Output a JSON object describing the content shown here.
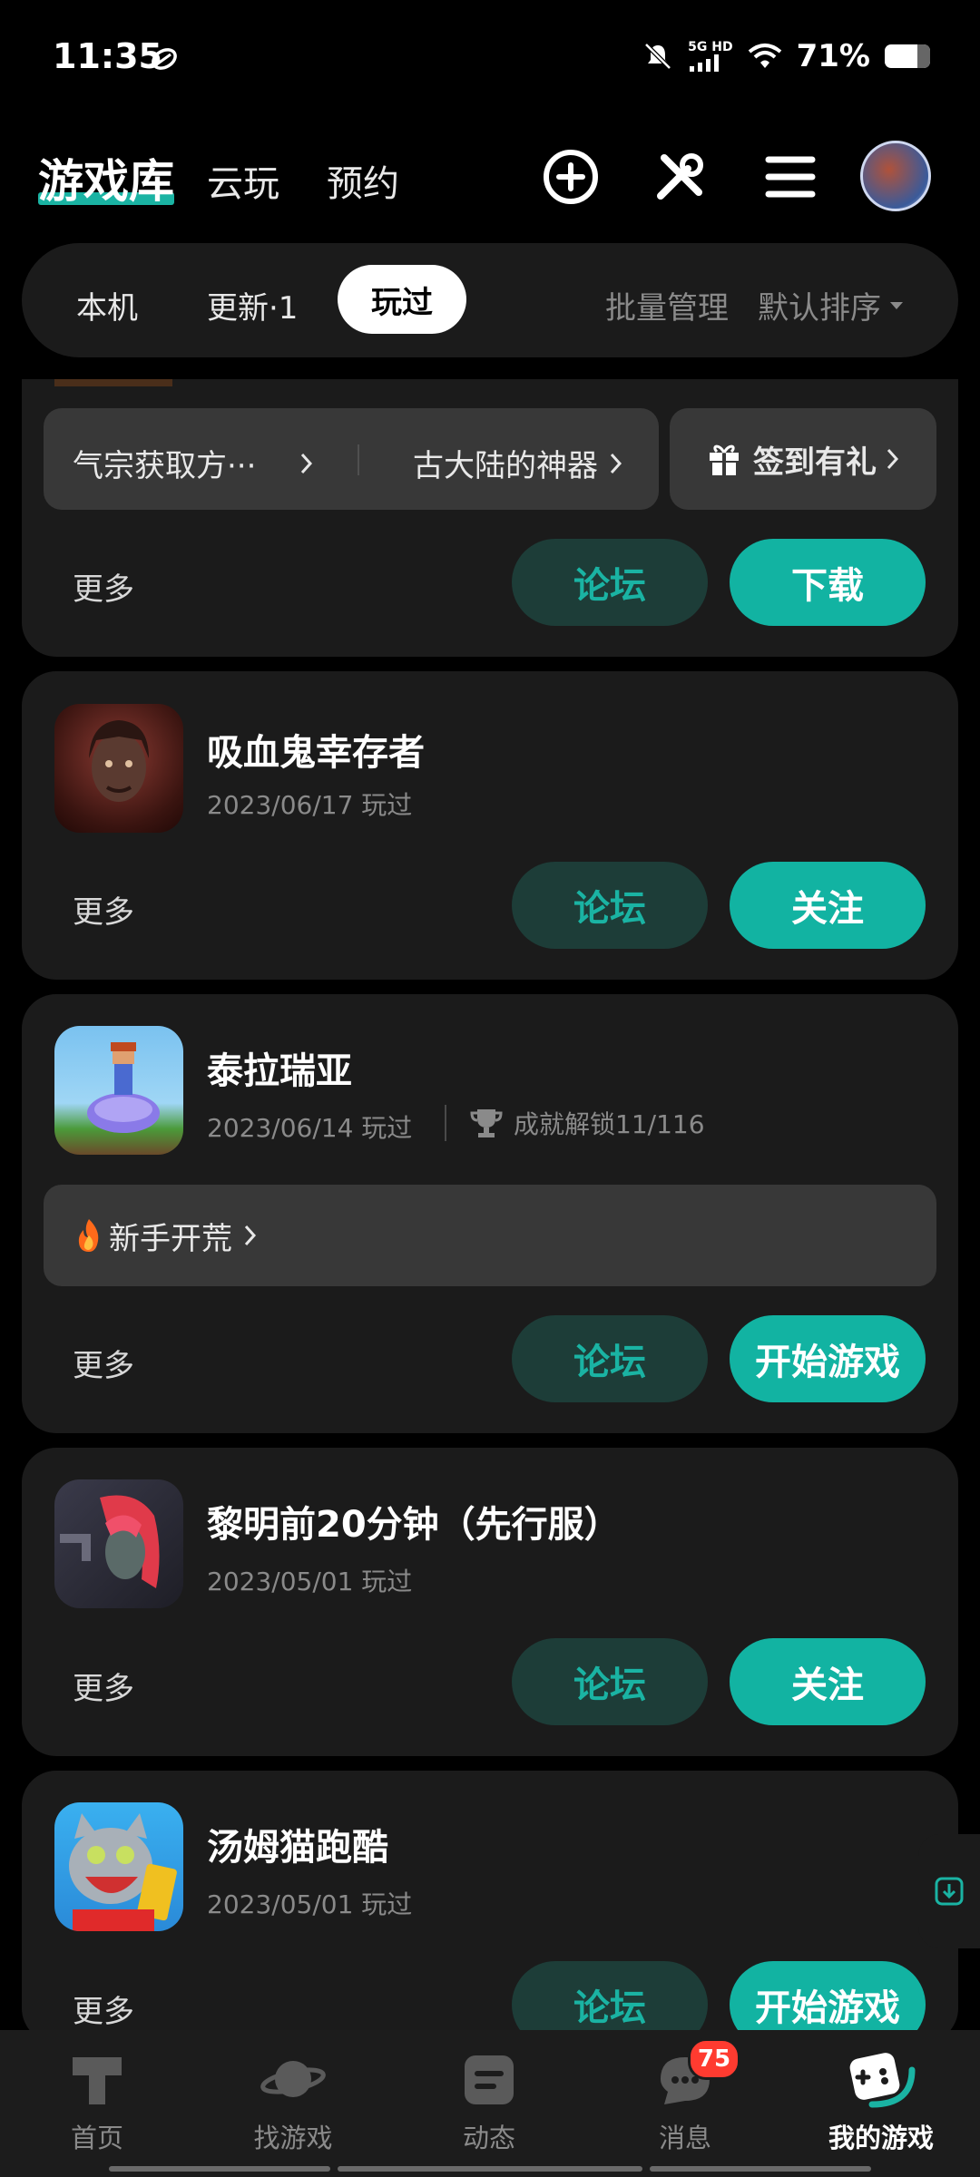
{
  "status_bar": {
    "time": "11:35",
    "network": "5G HD",
    "battery": "71%",
    "icons": [
      "nfc-icon",
      "mute-icon",
      "signal-icon",
      "wifi-icon",
      "battery-icon"
    ]
  },
  "header": {
    "logo": "游戏库",
    "tabs": [
      "云玩",
      "预约"
    ],
    "icons": [
      "add-icon",
      "tools-icon",
      "menu-icon",
      "avatar"
    ]
  },
  "filter": {
    "tabs": [
      "本机",
      "更新·1",
      "玩过"
    ],
    "active_tab": "玩过",
    "batch": "批量管理",
    "sort": "默认排序"
  },
  "card0": {
    "pill1": "气宗获取方···",
    "pill2": "古大陆的神器",
    "gift": "签到有礼",
    "more": "更多",
    "forum": "论坛",
    "action": "下载"
  },
  "games": [
    {
      "title": "吸血鬼幸存者",
      "date": "2023/06/17 玩过",
      "more": "更多",
      "forum": "论坛",
      "action": "关注"
    },
    {
      "title": "泰拉瑞亚",
      "date": "2023/06/14 玩过",
      "achievement": "成就解锁11/116",
      "pill": "新手开荒",
      "more": "更多",
      "forum": "论坛",
      "action": "开始游戏"
    },
    {
      "title": "黎明前20分钟（先行服）",
      "date": "2023/05/01 玩过",
      "more": "更多",
      "forum": "论坛",
      "action": "关注"
    },
    {
      "title": "汤姆猫跑酷",
      "date": "2023/05/01 玩过",
      "more": "更多",
      "forum": "论坛",
      "action": "开始游戏"
    }
  ],
  "bottom_nav": {
    "items": [
      "首页",
      "找游戏",
      "动态",
      "消息",
      "我的游戏"
    ],
    "active": "我的游戏",
    "badge": "75"
  },
  "colors": {
    "accent": "#12b3a2",
    "forum_bg": "#1d3d38",
    "card_bg": "#1b1b1b",
    "badge": "#ff3b30"
  }
}
